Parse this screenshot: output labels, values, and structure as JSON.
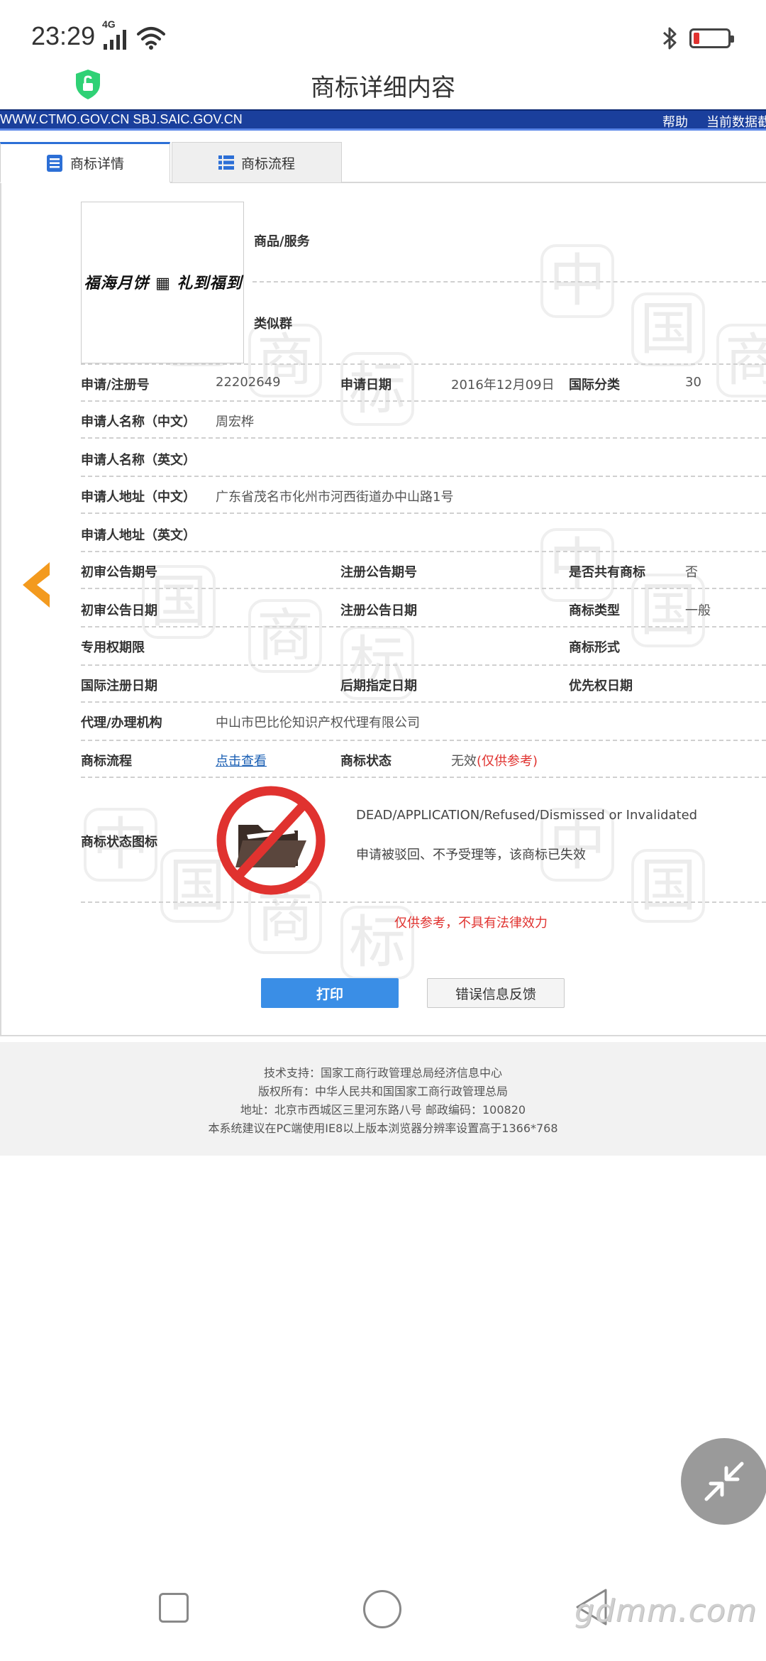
{
  "status_bar": {
    "time": "23:29",
    "network": "4G",
    "battery_color": "#e0322f"
  },
  "header": {
    "title": "商标详细内容",
    "shield_color": "#2fd175"
  },
  "url_bar": {
    "sites": "WWW.CTMO.GOV.CN SBJ.SAIC.GOV.CN",
    "help": "帮助",
    "data_label": "当前数据截"
  },
  "tabs": [
    {
      "label": "商标详情",
      "icon": "document-list-icon",
      "active": true
    },
    {
      "label": "商标流程",
      "icon": "grid-list-icon",
      "active": false
    }
  ],
  "trademark": {
    "image_text": "福海月饼 ▦ 礼到福到",
    "goods_label": "商品/服务",
    "similar_group_label": "类似群"
  },
  "fields": {
    "reg_no_label": "申请/注册号",
    "reg_no": "22202649",
    "apply_date_label": "申请日期",
    "apply_date": "2016年12月09日",
    "intl_class_label": "国际分类",
    "intl_class": "30",
    "applicant_cn_label": "申请人名称（中文）",
    "applicant_cn": "周宏桦",
    "applicant_en_label": "申请人名称（英文）",
    "address_cn_label": "申请人地址（中文）",
    "address_cn": "广东省茂名市化州市河西街道办中山路1号",
    "address_en_label": "申请人地址（英文）",
    "prelim_no_label": "初审公告期号",
    "reg_pub_no_label": "注册公告期号",
    "shared_label": "是否共有商标",
    "shared": "否",
    "prelim_date_label": "初审公告日期",
    "reg_pub_date_label": "注册公告日期",
    "tm_type_label": "商标类型",
    "tm_type": "一般",
    "exclusive_label": "专用权期限",
    "tm_form_label": "商标形式",
    "intl_reg_date_label": "国际注册日期",
    "later_designation_label": "后期指定日期",
    "priority_date_label": "优先权日期",
    "agent_label": "代理/办理机构",
    "agent": "中山市巴比伦知识产权代理有限公司",
    "process_label": "商标流程",
    "process_link": "点击查看",
    "status_label": "商标状态",
    "status_value": "无效",
    "status_note": "(仅供参考)",
    "status_icon_label": "商标状态图标",
    "status_en": "DEAD/APPLICATION/Refused/Dismissed or Invalidated",
    "status_cn": "申请被驳回、不予受理等，该商标已失效"
  },
  "disclaimer": "仅供参考，不具有法律效力",
  "buttons": {
    "print": "打印",
    "feedback": "错误信息反馈"
  },
  "footer": {
    "support": "技术支持：国家工商行政管理总局经济信息中心",
    "copyright": "版权所有：中华人民共和国国家工商行政管理总局",
    "address": "地址：北京市西城区三里河东路八号  邮政编码：100820",
    "recommendation": "本系统建议在PC端使用IE8以上版本浏览器分辨率设置高于1366*768"
  },
  "watermark_glyphs": [
    "中",
    "国",
    "商",
    "标"
  ],
  "site_watermark": "gdmm.com",
  "colors": {
    "url_bar_bg": "#1a3f9c",
    "link": "#1a5fb4",
    "alert_red": "#e0322f",
    "print_button": "#3a8ee6",
    "back_arrow": "#f39a1e"
  }
}
